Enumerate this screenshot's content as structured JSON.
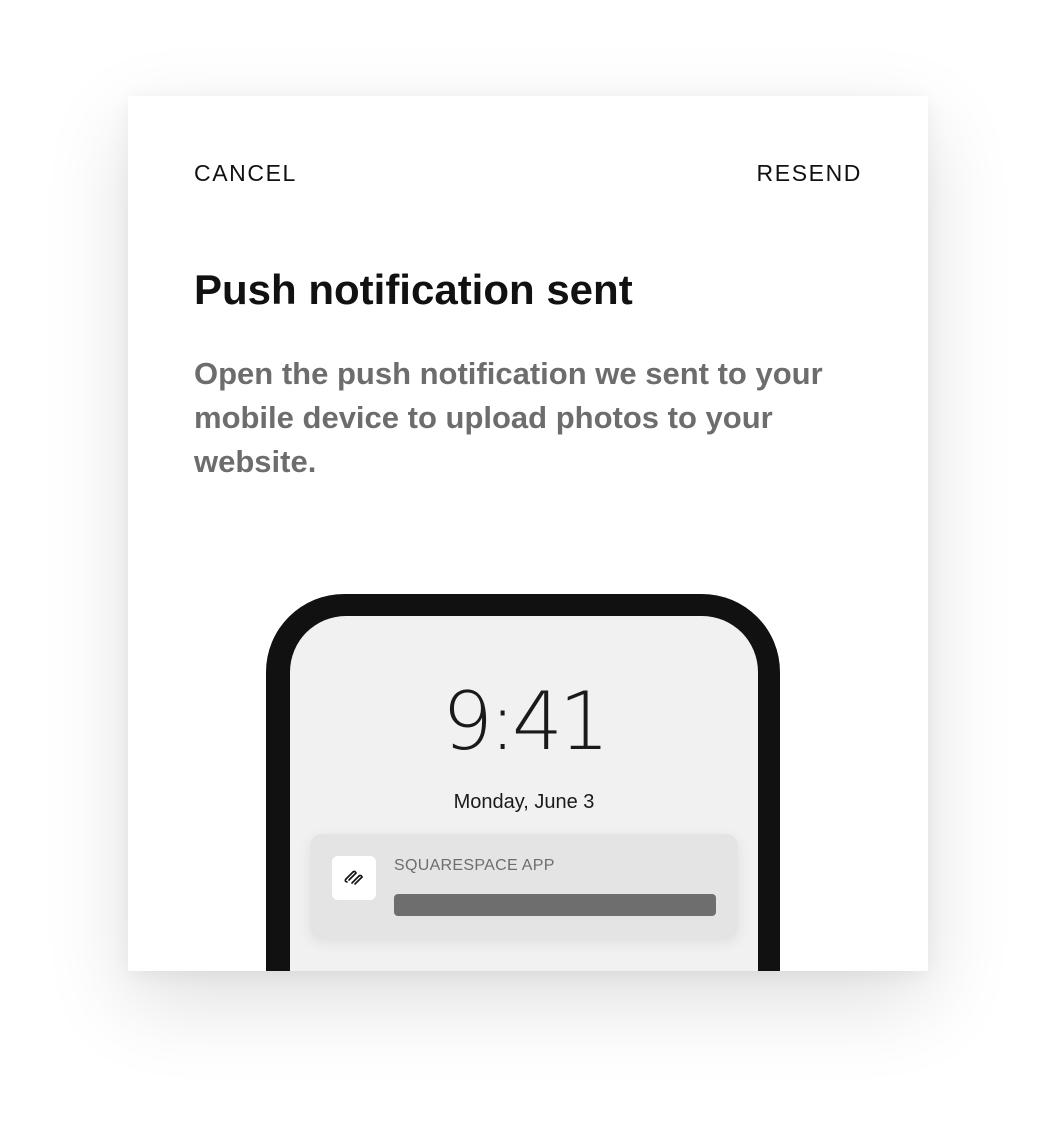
{
  "header": {
    "cancel_label": "CANCEL",
    "resend_label": "RESEND"
  },
  "main": {
    "title": "Push notification sent",
    "description": "Open the push notification we sent to your mobile device to upload photos to your website."
  },
  "phone": {
    "time": "9:41",
    "date": "Monday, June 3",
    "notification": {
      "app_name": "SQUARESPACE APP",
      "icon": "squarespace-logo-icon"
    }
  },
  "colors": {
    "text_primary": "#111111",
    "text_secondary": "#6d6d6d",
    "phone_frame": "#111111",
    "screen_bg": "#f1f1f1",
    "notification_bg": "#e4e4e4"
  }
}
